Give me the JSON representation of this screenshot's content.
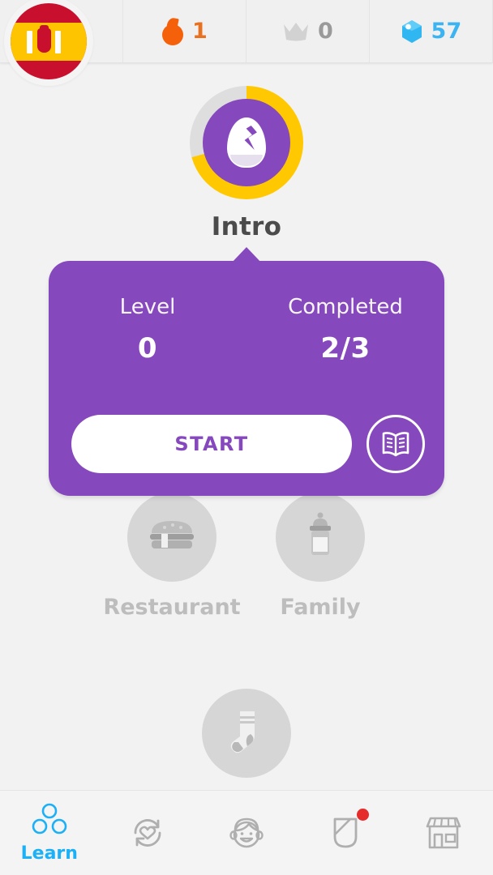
{
  "header": {
    "flag": {
      "name": "spanish-flag",
      "language": "Spanish"
    },
    "stats": [
      {
        "icon": "flame-icon",
        "name": "streak",
        "value": "1",
        "color": "#e8701f"
      },
      {
        "icon": "crown-icon",
        "name": "crowns",
        "value": "0",
        "color": "#9a9a9a"
      },
      {
        "icon": "gem-icon",
        "name": "gems",
        "value": "57",
        "color": "#3db4f2"
      }
    ]
  },
  "tree": {
    "active_skill": {
      "label": "Intro",
      "icon": "egg-icon",
      "progress_percent": 71,
      "ring_color": "#ffc800",
      "ring_track_color": "#dedede",
      "bubble_color": "#8548bd"
    },
    "locked_skills": [
      {
        "label": "Restaurant",
        "icon": "burger-icon"
      },
      {
        "label": "Family",
        "icon": "baby-bottle-icon"
      },
      {
        "label": "",
        "icon": "sock-icon"
      }
    ]
  },
  "popup": {
    "accent_color": "#8548bd",
    "stats": [
      {
        "label": "Level",
        "value": "0"
      },
      {
        "label": "Completed",
        "value": "2/3"
      }
    ],
    "start_label": "START",
    "tips_icon": "book-icon"
  },
  "bottom_nav": {
    "active_color": "#1cb0f6",
    "inactive_color": "#afafaf",
    "items": [
      {
        "label": "Learn",
        "icon": "learn-circles-icon",
        "active": true,
        "badge": false
      },
      {
        "label": "",
        "icon": "practice-heart-refresh-icon",
        "active": false,
        "badge": false
      },
      {
        "label": "",
        "icon": "profile-face-icon",
        "active": false,
        "badge": false
      },
      {
        "label": "",
        "icon": "quests-shield-icon",
        "active": false,
        "badge": true
      },
      {
        "label": "",
        "icon": "shop-store-icon",
        "active": false,
        "badge": false
      }
    ]
  }
}
